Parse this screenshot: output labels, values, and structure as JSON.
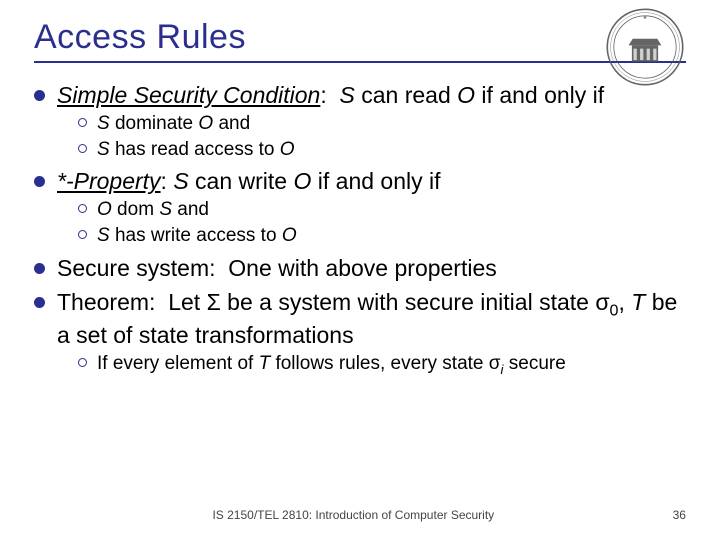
{
  "title": "Access Rules",
  "seal_name": "university-seal",
  "bullets": {
    "b1_html": "<span class='i u'>Simple Security Condition</span>:&nbsp; <span class='i'>S</span> can read <span class='i'>O</span> if and only if",
    "b1a_html": "<span class='i'>S</span> dominate <span class='i'>O</span> and",
    "b1b_html": "<span class='i'>S</span> has read access to <span class='i'>O</span>",
    "b2_html": "<span class='i u'>*-Property</span>: <span class='i'>S</span> can write <span class='i'>O</span> if and only if",
    "b2a_html": "<span class='i'>O</span> dom <span class='i'>S</span> and",
    "b2b_html": "<span class='i'>S</span> has write access to <span class='i'>O</span>",
    "b3_html": "Secure system:&nbsp; One with above properties",
    "b4_html": "Theorem:&nbsp; Let Σ be a system with secure initial state σ<span class='sub'>0</span>, <span class='i'>T</span> be a set of state transformations",
    "b4a_html": "If every element of <span class='i'>T</span> follows rules, every state σ<span class='sub i'>i</span> secure"
  },
  "footer": {
    "course": "IS 2150/TEL 2810: Introduction of Computer Security",
    "page": "36"
  }
}
